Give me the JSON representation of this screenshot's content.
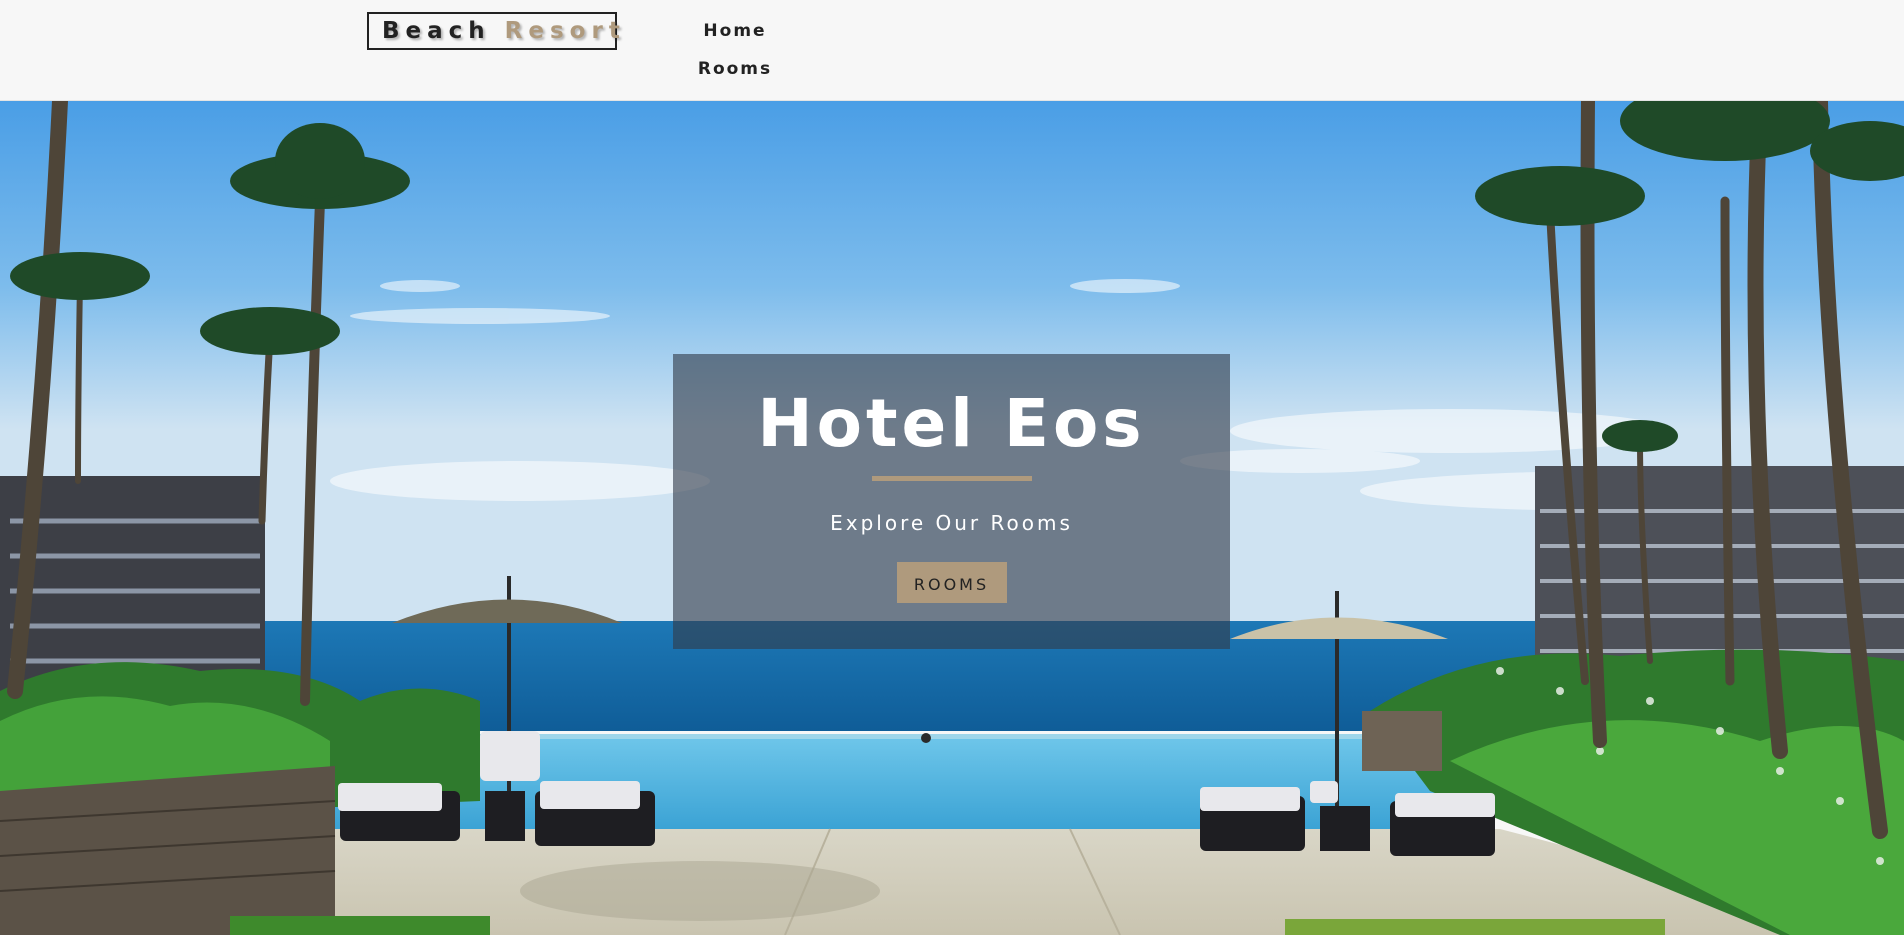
{
  "navbar": {
    "logo": {
      "word1": "Beach",
      "word2": "Resort"
    },
    "links": [
      {
        "label": "Home"
      },
      {
        "label": "Rooms"
      }
    ]
  },
  "hero": {
    "title": "Hotel Eos",
    "subtitle": "Explore Our Rooms",
    "button_label": "ROOMS"
  },
  "colors": {
    "accent": "#af9a7d",
    "text_dark": "#222222",
    "navbar_bg": "#f7f7f7",
    "banner_overlay": "rgba(50,60,75,0.62)"
  }
}
